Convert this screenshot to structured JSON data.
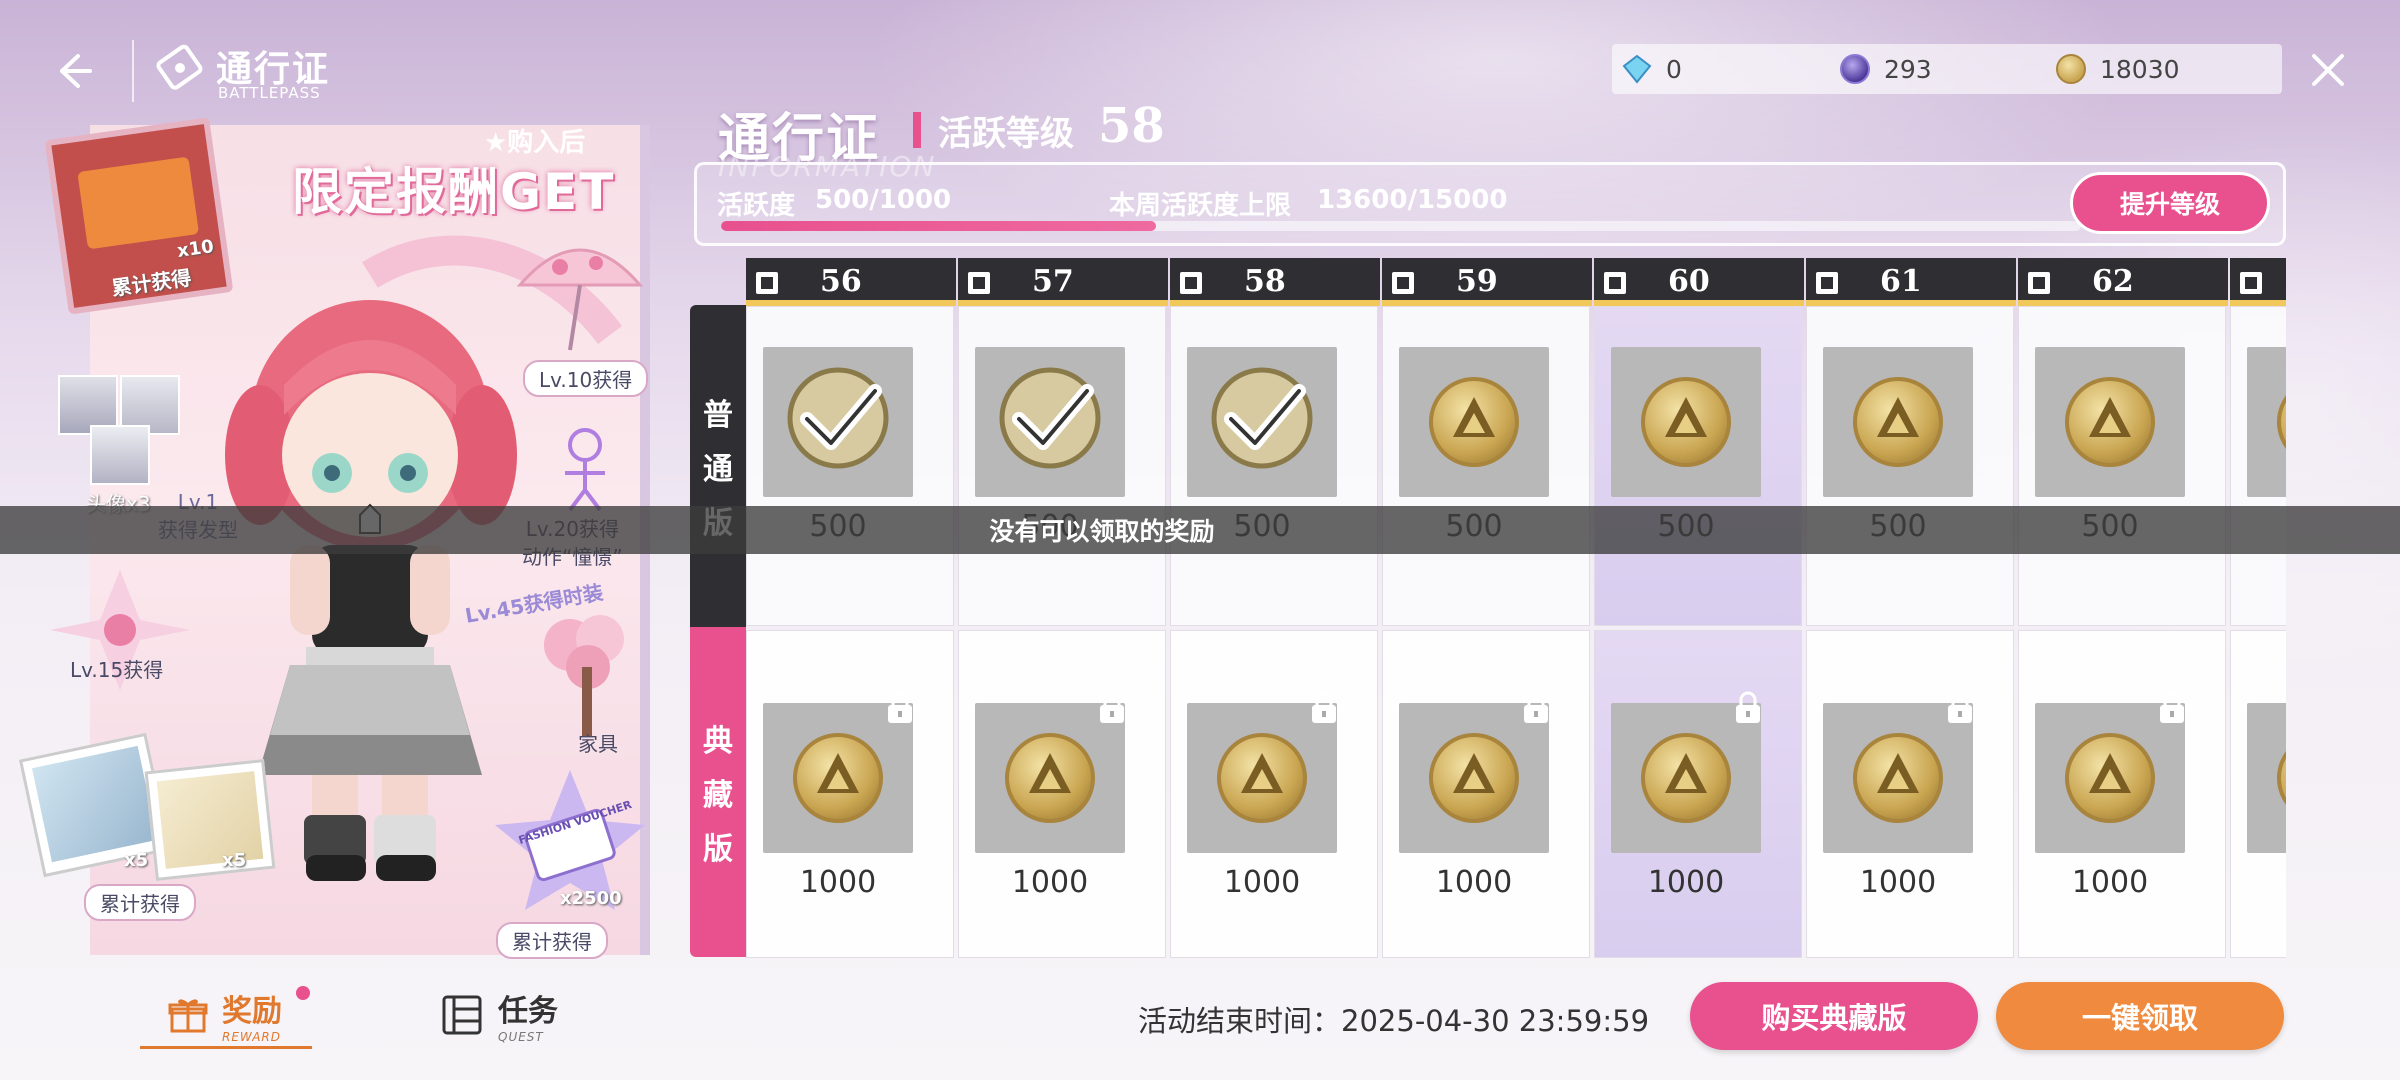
{
  "header": {
    "title": "通行证",
    "subtitle": "BATTLEPASS"
  },
  "currencies": [
    {
      "icon": "diamond-icon",
      "value": "0"
    },
    {
      "icon": "orb-icon",
      "value": "293"
    },
    {
      "icon": "gold-coin-icon",
      "value": "18030"
    }
  ],
  "promo": {
    "after_purchase": "★购入后",
    "headline": "限定报酬GET",
    "box_count": "x10",
    "cumulative_1": "累计获得",
    "umbrella_label": "Lv.10获得",
    "avatars_label": "头像x3",
    "hair_label": "Lv.1\n获得发型",
    "emote_label": "Lv.20获得\n动作“憧憬”",
    "outfit_label": "Lv.45获得时装",
    "lv15_label": "Lv.15获得",
    "furniture_label": "家具",
    "photo_x5_a": "x5",
    "photo_x5_b": "x5",
    "cumulative_2": "累计获得",
    "voucher_count": "x2500",
    "cumulative_3": "累计获得",
    "voucher_text": "FASHION VOUCHER"
  },
  "pass": {
    "title": "通行证",
    "level_label": "活跃等级",
    "level": "58",
    "info_watermark": "INFORMATION",
    "activity_label": "活跃度",
    "activity_value": "500/1000",
    "activity_progress": 0.32,
    "weekly_label": "本周活跃度上限",
    "weekly_value": "13600/15000",
    "upgrade_button": "提升等级"
  },
  "tracks": {
    "normal_label": [
      "普",
      "通",
      "版"
    ],
    "premium_label": [
      "典",
      "藏",
      "版"
    ]
  },
  "columns": [
    {
      "level": "56",
      "normal_amount": "500",
      "premium_amount": "1000",
      "claimed": true,
      "current": false
    },
    {
      "level": "57",
      "normal_amount": "500",
      "premium_amount": "1000",
      "claimed": true,
      "current": false
    },
    {
      "level": "58",
      "normal_amount": "500",
      "premium_amount": "1000",
      "claimed": true,
      "current": false
    },
    {
      "level": "59",
      "normal_amount": "500",
      "premium_amount": "1000",
      "claimed": false,
      "current": false
    },
    {
      "level": "60",
      "normal_amount": "500",
      "premium_amount": "1000",
      "claimed": false,
      "current": true
    },
    {
      "level": "61",
      "normal_amount": "500",
      "premium_amount": "1000",
      "claimed": false,
      "current": false
    },
    {
      "level": "62",
      "normal_amount": "500",
      "premium_amount": "1000",
      "claimed": false,
      "current": false
    },
    {
      "level": "",
      "normal_amount": "",
      "premium_amount": "",
      "claimed": false,
      "current": false
    }
  ],
  "toast": "没有可以领取的奖励",
  "bottom": {
    "tab_reward": "奖励",
    "tab_reward_en": "REWARD",
    "tab_quest": "任务",
    "tab_quest_en": "QUEST",
    "end_time_label": "活动结束时间：",
    "end_time": "2025-04-30 23:59:59",
    "buy_premium": "购买典藏版",
    "claim_all": "一键领取"
  },
  "colors": {
    "accent_pink": "#e8508e",
    "accent_orange": "#ef8a3e",
    "header_dark": "#2f2f33",
    "gold": "#f2c85b"
  }
}
